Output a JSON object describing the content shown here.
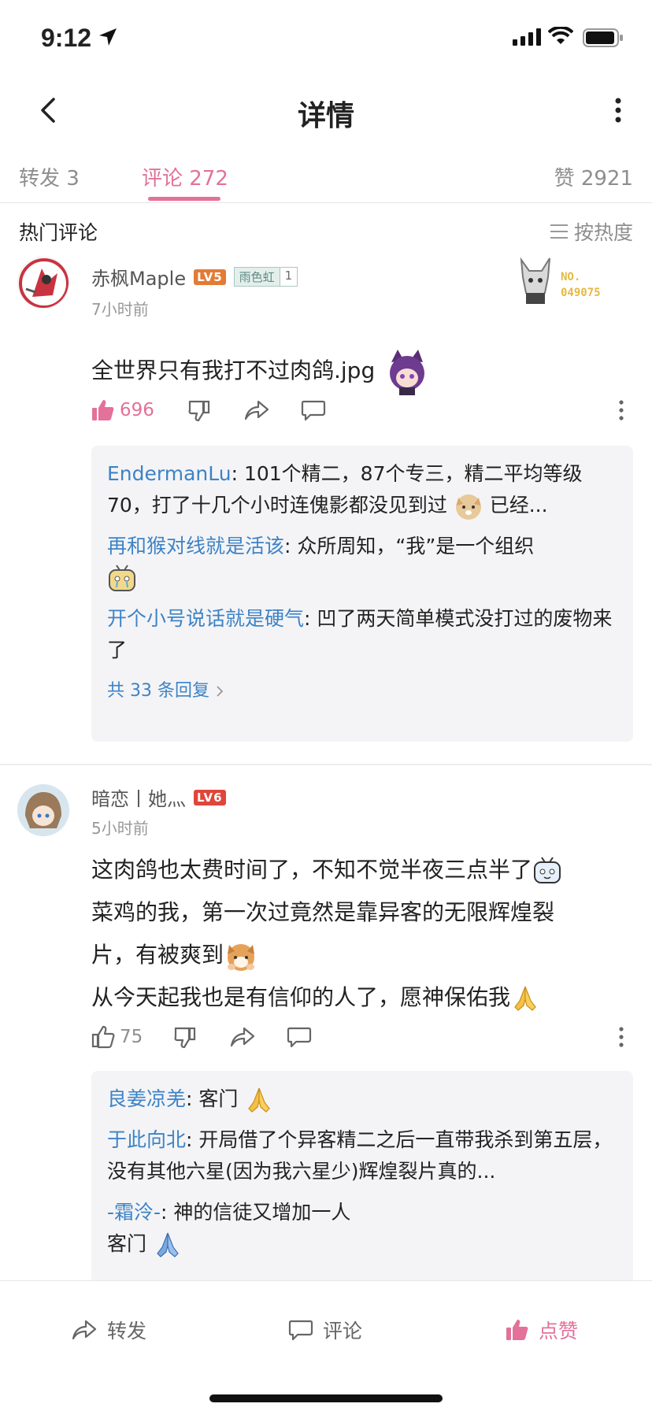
{
  "status": {
    "time": "9:12"
  },
  "header": {
    "title": "详情"
  },
  "tabs": {
    "repost": "转发 3",
    "comment": "评论 272",
    "like": "赞 2921"
  },
  "section": {
    "hot": "热门评论",
    "sort": "按热度"
  },
  "comments": [
    {
      "user": "赤枫Maple",
      "level": "LV5",
      "level_color": "#e27b36",
      "fan_badge": "雨色虹",
      "fan_badge_num": "1",
      "decoration_no": "NO.",
      "decoration_code": "049075",
      "time": "7小时前",
      "text": "全世界只有我打不过肉鸽.jpg",
      "likes": "696",
      "liked": true,
      "replies": [
        {
          "user": "EndermanLu",
          "text": ": 101个精二，87个专三，精二平均等级70，打了十几个小时连傀影都没见到过",
          "tail": " 已经..."
        },
        {
          "user": "再和猴对线就是活该",
          "text": ": 众所周知，“我”是一个组织"
        },
        {
          "user": "开个小号说话就是硬气",
          "text": ": 凹了两天简单模式没打过的废物来了"
        }
      ],
      "more_replies": "共 33 条回复"
    },
    {
      "user": "暗恋丨她灬",
      "level": "LV6",
      "level_color": "#e0463b",
      "time": "5小时前",
      "text_lines": [
        "这肉鸽也太费时间了，不知不觉半夜三点半了",
        "菜鸡的我，第一次过竟然是靠异客的无限辉煌裂",
        "片，有被爽到",
        "从今天起我也是有信仰的人了，愿神保佑我"
      ],
      "likes": "75",
      "liked": false,
      "replies": [
        {
          "user": "良姜凉羌",
          "text": ": 客门"
        },
        {
          "user": "于此向北",
          "text": ": 开局借了个异客精二之后一直带我杀到第五层，没有其他六星(因为我六星少)辉煌裂片真的..."
        },
        {
          "user": "-霜泠-",
          "text": ": 神的信徒又增加一人"
        },
        {
          "user": "",
          "text": "客门"
        }
      ]
    }
  ],
  "bottom": {
    "repost": "转发",
    "comment": "评论",
    "like": "点赞"
  },
  "colors": {
    "accent": "#e3719a",
    "link": "#3d83c6"
  }
}
